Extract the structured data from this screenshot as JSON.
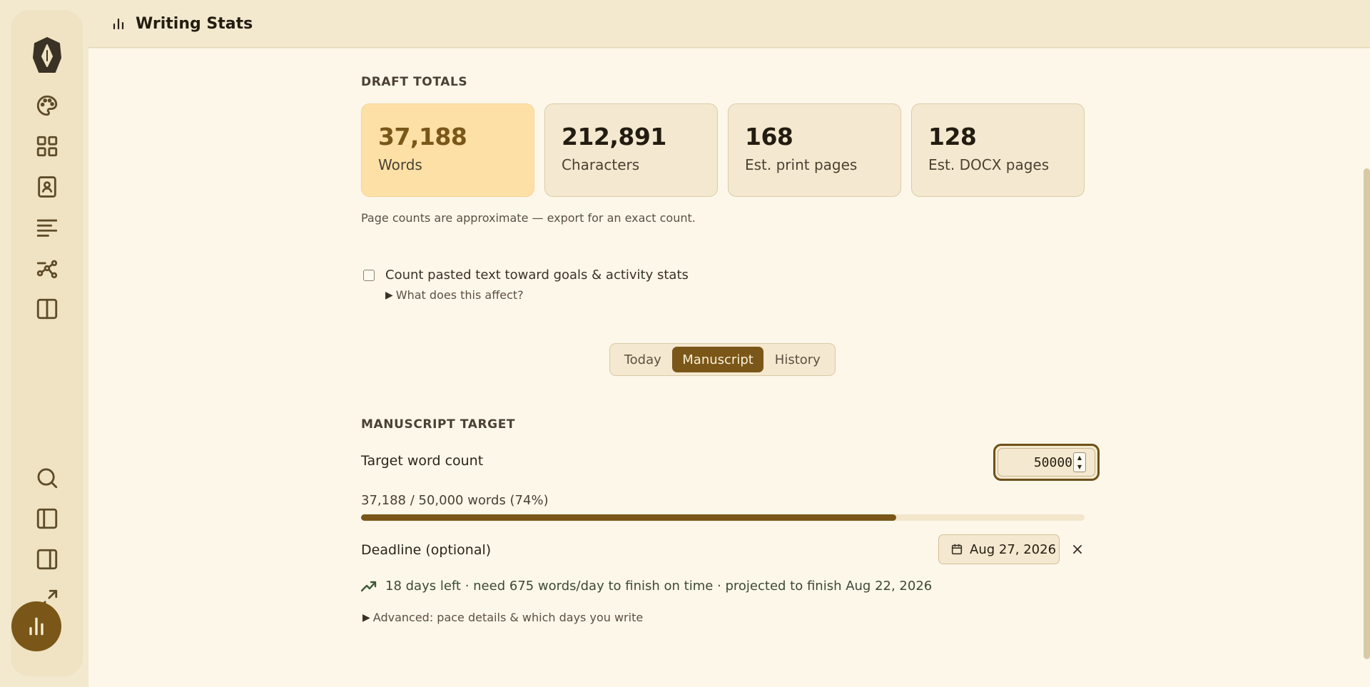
{
  "header": {
    "title": "Writing Stats"
  },
  "rail": {
    "icons": [
      "app-logo",
      "palette-icon",
      "grid-icon",
      "contact-book-icon",
      "align-left-icon",
      "workflow-icon",
      "split-view-icon",
      "search-icon",
      "sidebar-left-icon",
      "sidebar-right-icon",
      "expand-icon",
      "bar-chart-icon"
    ]
  },
  "draft_totals": {
    "title": "DRAFT TOTALS",
    "cards": [
      {
        "value": "37,188",
        "label": "Words"
      },
      {
        "value": "212,891",
        "label": "Characters"
      },
      {
        "value": "168",
        "label": "Est. print pages"
      },
      {
        "value": "128",
        "label": "Est. DOCX pages"
      }
    ],
    "note": "Page counts are approximate — export for an exact count."
  },
  "paste_option": {
    "label": "Count pasted text toward goals & activity stats",
    "checked": false,
    "disclosure": "What does this affect?"
  },
  "tabs": {
    "today": "Today",
    "manuscript": "Manuscript",
    "history": "History",
    "selected": "Manuscript"
  },
  "manuscript_target": {
    "title": "MANUSCRIPT TARGET",
    "target_label": "Target word count",
    "target_value": "50000",
    "progress_text": "37,188 / 50,000 words (74%)",
    "progress_fraction": 0.74,
    "deadline_label": "Deadline (optional)",
    "deadline_value": "Aug 27, 2026",
    "clear_symbol": "×",
    "pace_text": "18 days left · need 675 words/day to finish on time · projected to finish Aug 22, 2026",
    "advanced_disclosure": "Advanced: pace details & which days you write"
  },
  "colors": {
    "accent": "#7a5618",
    "highlight_card": "#fde0a6",
    "background": "#fdf7ea",
    "pace": "#3d5a37"
  }
}
